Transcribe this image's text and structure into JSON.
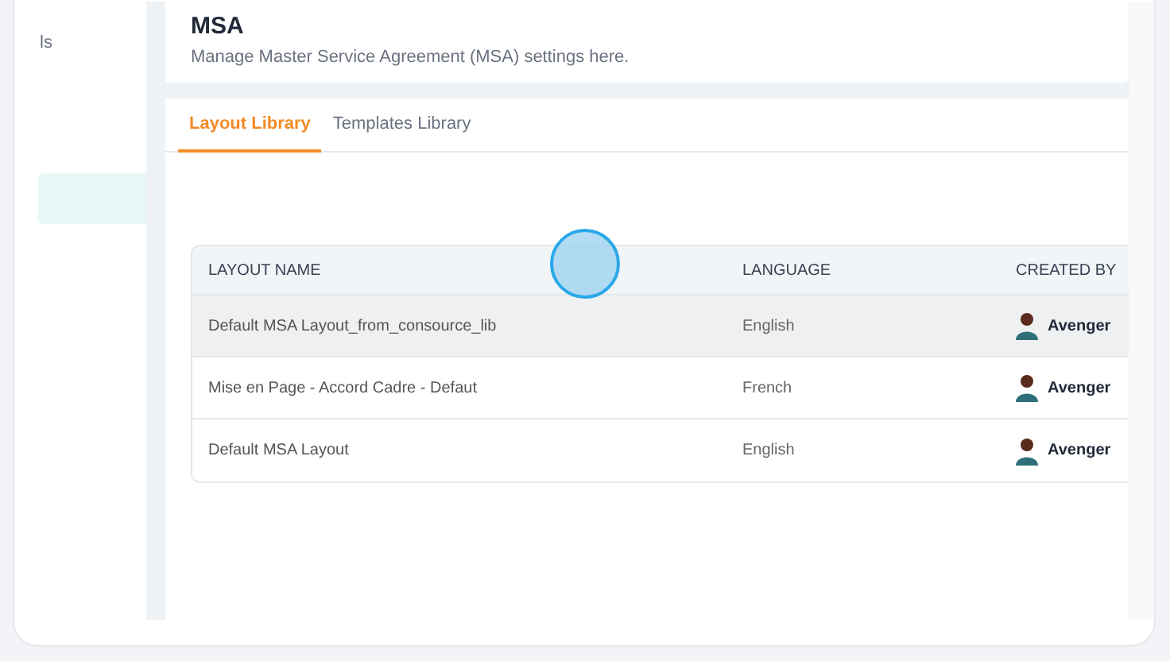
{
  "sidebar": {
    "items": [
      {
        "label": "ls",
        "selected": false
      },
      {
        "selected": true
      }
    ]
  },
  "header": {
    "title": "MSA",
    "subtitle": "Manage Master Service Agreement (MSA) settings here."
  },
  "tabs": [
    {
      "label": "Layout Library",
      "selected": true
    },
    {
      "label": "Templates Library",
      "selected": false
    }
  ],
  "table": {
    "columns": [
      "LAYOUT NAME",
      "LANGUAGE",
      "CREATED BY"
    ],
    "rows": [
      {
        "name": "Default MSA Layout_from_consource_lib",
        "language": "English",
        "created_by": "Avenger",
        "hovered": true
      },
      {
        "name": "Mise en Page - Accord Cadre - Defaut",
        "language": "French",
        "created_by": "Avenger",
        "hovered": false
      },
      {
        "name": "Default MSA Layout",
        "language": "English",
        "created_by": "Avenger",
        "hovered": false
      }
    ]
  }
}
